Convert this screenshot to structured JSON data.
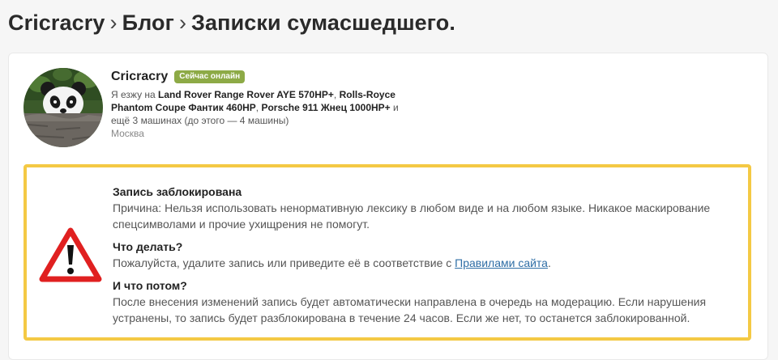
{
  "breadcrumb": {
    "items": [
      "Cricracry",
      "Блог",
      "Записки сумасшедшего."
    ],
    "separator": "›"
  },
  "user": {
    "name": "Cricracry",
    "badge": "Сейчас онлайн",
    "cars_prefix": "Я езжу на ",
    "car1": "Land Rover Range Rover AYE 570HP+",
    "comma1": ", ",
    "car2": "Rolls-Royce Phantom Coupe Фантик 460HP",
    "comma2": ", ",
    "car3": "Porsche 911 Жнец 1000HP+",
    "cars_suffix": " и ещё 3 машинах (до этого — 4 машины)",
    "city": "Москва"
  },
  "blocked": {
    "title": "Запись заблокирована",
    "reason": "Причина: Нельзя использовать ненормативную лексику в любом виде и на любом языке. Никакое маскирование спецсимволами и прочие ухищрения не помогут.",
    "what_title": "Что делать?",
    "what_text_before": "Пожалуйста, удалите запись или приведите её в соответствие с ",
    "rules_link": "Правилами сайта",
    "what_text_after": ".",
    "then_title": "И что потом?",
    "then_text": "После внесения изменений запись будет автоматически направлена в очередь на модерацию. Если нарушения устранены, то запись будет разблокирована в течение 24 часов. Если же нет, то останется заблокированной."
  },
  "colors": {
    "badge": "#8daa46",
    "border": "#f4c944",
    "warning": "#e02020",
    "link": "#2f6ea6"
  },
  "icons": {
    "avatar": "panda-avatar",
    "warning": "warning-triangle-icon"
  }
}
